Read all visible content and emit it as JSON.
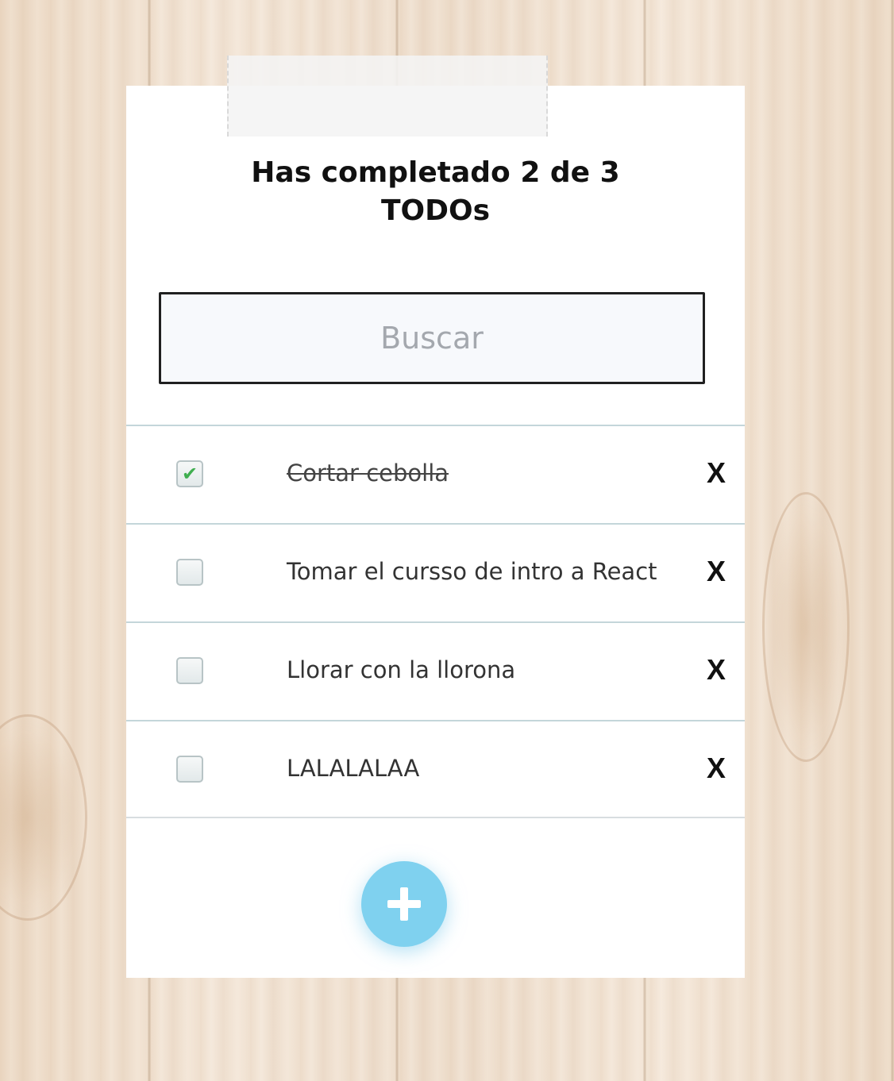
{
  "header": {
    "counter_text": "Has completado 2 de 3 TODOs"
  },
  "search": {
    "placeholder": "Buscar",
    "value": ""
  },
  "todos": [
    {
      "text": "Cortar cebolla",
      "completed": true,
      "delete_label": "X"
    },
    {
      "text": "Tomar el cursso de intro a React",
      "completed": false,
      "delete_label": "X"
    },
    {
      "text": "Llorar con la llorona",
      "completed": false,
      "delete_label": "X"
    },
    {
      "text": "LALALALAA",
      "completed": false,
      "delete_label": "X"
    }
  ],
  "add_button": {
    "icon": "plus-icon",
    "color": "#7fd1ef"
  },
  "icons": {
    "check": "check-icon",
    "delete": "close-icon"
  }
}
